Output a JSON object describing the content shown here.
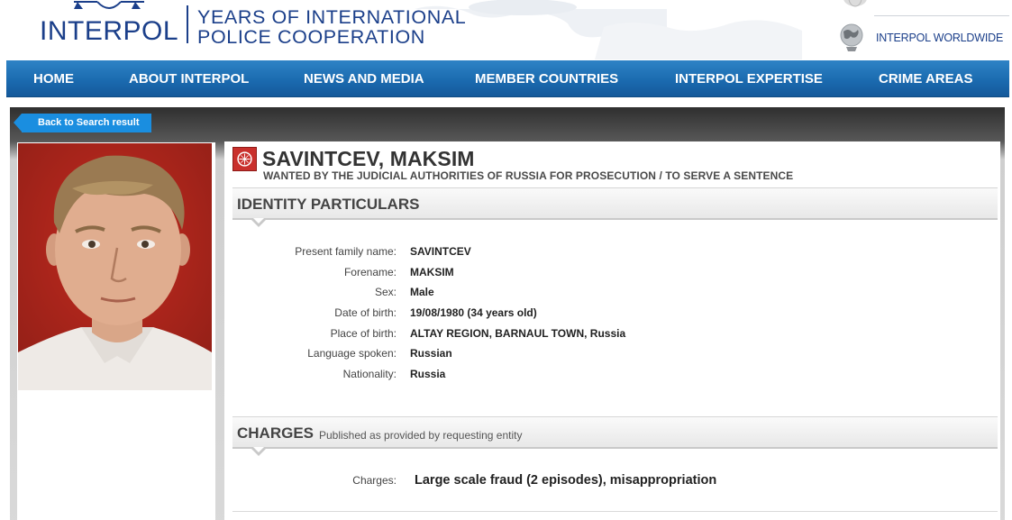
{
  "header": {
    "logo_text": "INTERPOL",
    "anniversary_line1": "YEARS OF INTERNATIONAL",
    "anniversary_line2": "POLICE COOPERATION",
    "worldwide_link": "INTERPOL WORLDWIDE"
  },
  "nav": {
    "items": [
      {
        "label": "HOME"
      },
      {
        "label": "ABOUT INTERPOL"
      },
      {
        "label": "NEWS AND MEDIA"
      },
      {
        "label": "MEMBER COUNTRIES"
      },
      {
        "label": "INTERPOL EXPERTISE"
      },
      {
        "label": "CRIME AREAS"
      }
    ]
  },
  "back_button": {
    "label": "Back to Search result"
  },
  "notice": {
    "name": "SAVINTCEV, MAKSIM",
    "wanted_text": "WANTED BY THE JUDICIAL AUTHORITIES OF RUSSIA FOR PROSECUTION / TO SERVE A SENTENCE",
    "notice_icon": "red-notice-icon"
  },
  "identity": {
    "title": "IDENTITY PARTICULARS",
    "fields": [
      {
        "label": "Present family name:",
        "value": "SAVINTCEV"
      },
      {
        "label": "Forename:",
        "value": "MAKSIM"
      },
      {
        "label": "Sex:",
        "value": "Male"
      },
      {
        "label": "Date of birth:",
        "value": "19/08/1980 (34 years old)"
      },
      {
        "label": "Place of birth:",
        "value": "ALTAY REGION, BARNAUL TOWN, Russia"
      },
      {
        "label": "Language spoken:",
        "value": "Russian"
      },
      {
        "label": "Nationality:",
        "value": "Russia"
      }
    ]
  },
  "charges": {
    "title": "CHARGES",
    "subtitle": "Published as provided by requesting entity",
    "label": "Charges:",
    "value": "Large scale fraud (2 episodes), misappropriation"
  },
  "colors": {
    "brand_blue": "#1b3f8a",
    "nav_blue": "#1b6bb0",
    "button_blue": "#1a8ee0",
    "notice_red": "#c9302c"
  }
}
